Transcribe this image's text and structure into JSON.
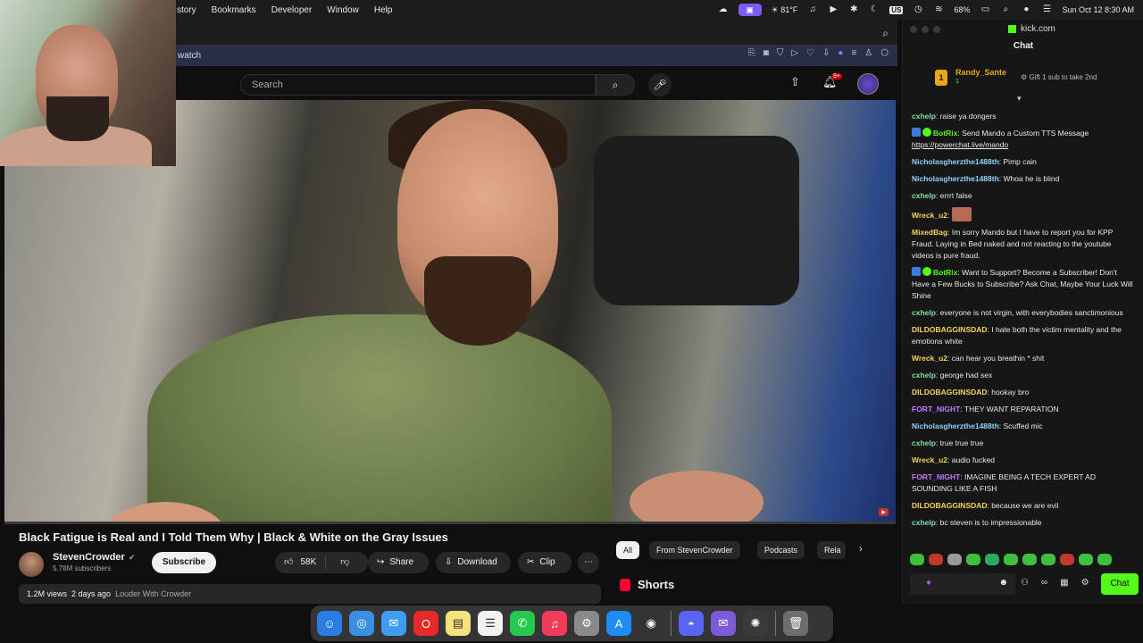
{
  "menubar": {
    "menus": [
      "story",
      "Bookmarks",
      "Developer",
      "Window",
      "Help"
    ],
    "temperature": "81°F",
    "battery": "68%",
    "input_badge": "US",
    "datetime": "Sun Oct 12  8:30 AM"
  },
  "browser": {
    "url_fragment": "watch"
  },
  "youtube": {
    "search_placeholder": "Search",
    "notification_count": "9+",
    "video": {
      "title": "Black Fatigue is Real and I Told Them Why | Black & White on the Gray Issues",
      "progress_fraction": 0.0
    },
    "channel": {
      "name": "StevenCrowder",
      "subscribers": "5.78M subscribers",
      "subscribe_label": "Subscribe"
    },
    "actions": {
      "likes": "58K",
      "share": "Share",
      "download": "Download",
      "clip": "Clip"
    },
    "meta": {
      "views": "1.2M views",
      "age": "2 days ago",
      "tag": "Louder With Crowder"
    },
    "chips": [
      "All",
      "From StevenCrowder",
      "Podcasts",
      "Rela"
    ],
    "shorts_label": "Shorts"
  },
  "kick": {
    "site": "kick.com",
    "header": "Chat",
    "pinned": {
      "user": "Randy_Sante",
      "count": "1",
      "message": "Gift 1 sub to take 2nd"
    },
    "messages": [
      {
        "user": "cxhelp",
        "color": "#7ee0a6",
        "text": "raise ya dongers"
      },
      {
        "user": "BotRix",
        "color": "#53fc18",
        "bot": true,
        "text": "Send Mando a Custom TTS Message",
        "link": "https://powerchat.live/mando"
      },
      {
        "user": "Nicholasgherzthe1488th",
        "color": "#8fd4f5",
        "text": "Pimp cain"
      },
      {
        "user": "Nicholasgherzthe1488th",
        "color": "#8fd4f5",
        "text": "Whoa he is blind"
      },
      {
        "user": "cxhelp",
        "color": "#7ee0a6",
        "text": "errrt false"
      },
      {
        "user": "Wreck_u2",
        "color": "#f5d35a",
        "emote": true,
        "text": ""
      },
      {
        "user": "MixedBag",
        "color": "#f5d35a",
        "text": "Im sorry Mando but I have to report you for KPP Fraud. Laying in Bed naked and not reacting to the youtube videos is pure fraud."
      },
      {
        "user": "BotRix",
        "color": "#53fc18",
        "bot": true,
        "text": "Want to Support? Become a Subscriber! Don't Have a Few Bucks to Subscribe? Ask Chat, Maybe Your Luck Will Shine"
      },
      {
        "user": "cxhelp",
        "color": "#7ee0a6",
        "text": "everyone is not virgin, with everybodies sanctimonious"
      },
      {
        "user": "DILDOBAGGINSDAD",
        "color": "#f5d35a",
        "text": "I hate both the victim mentality and the emotions white"
      },
      {
        "user": "Wreck_u2",
        "color": "#f5d35a",
        "text": "can hear you breathin * shit"
      },
      {
        "user": "cxhelp",
        "color": "#7ee0a6",
        "text": "george had sex"
      },
      {
        "user": "DILDOBAGGINSDAD",
        "color": "#f5d35a",
        "text": "hookay bro"
      },
      {
        "user": "FORT_NIGHT",
        "color": "#c57bff",
        "text": "THEY WANT REPARATION"
      },
      {
        "user": "Nicholasgherzthe1488th",
        "color": "#8fd4f5",
        "text": "Scuffed mic"
      },
      {
        "user": "cxhelp",
        "color": "#7ee0a6",
        "text": "true true true"
      },
      {
        "user": "Wreck_u2",
        "color": "#f5d35a",
        "text": "audio fucked"
      },
      {
        "user": "FORT_NIGHT",
        "color": "#c57bff",
        "text": "IMAGINE BEING A TECH EXPERT AD SOUNDING LIKE A FISH"
      },
      {
        "user": "DILDOBAGGINSDAD",
        "color": "#f5d35a",
        "text": "because we are evil"
      },
      {
        "user": "cxhelp",
        "color": "#7ee0a6",
        "text": "bc steven is to impressionable"
      }
    ],
    "send_label": "Chat"
  }
}
